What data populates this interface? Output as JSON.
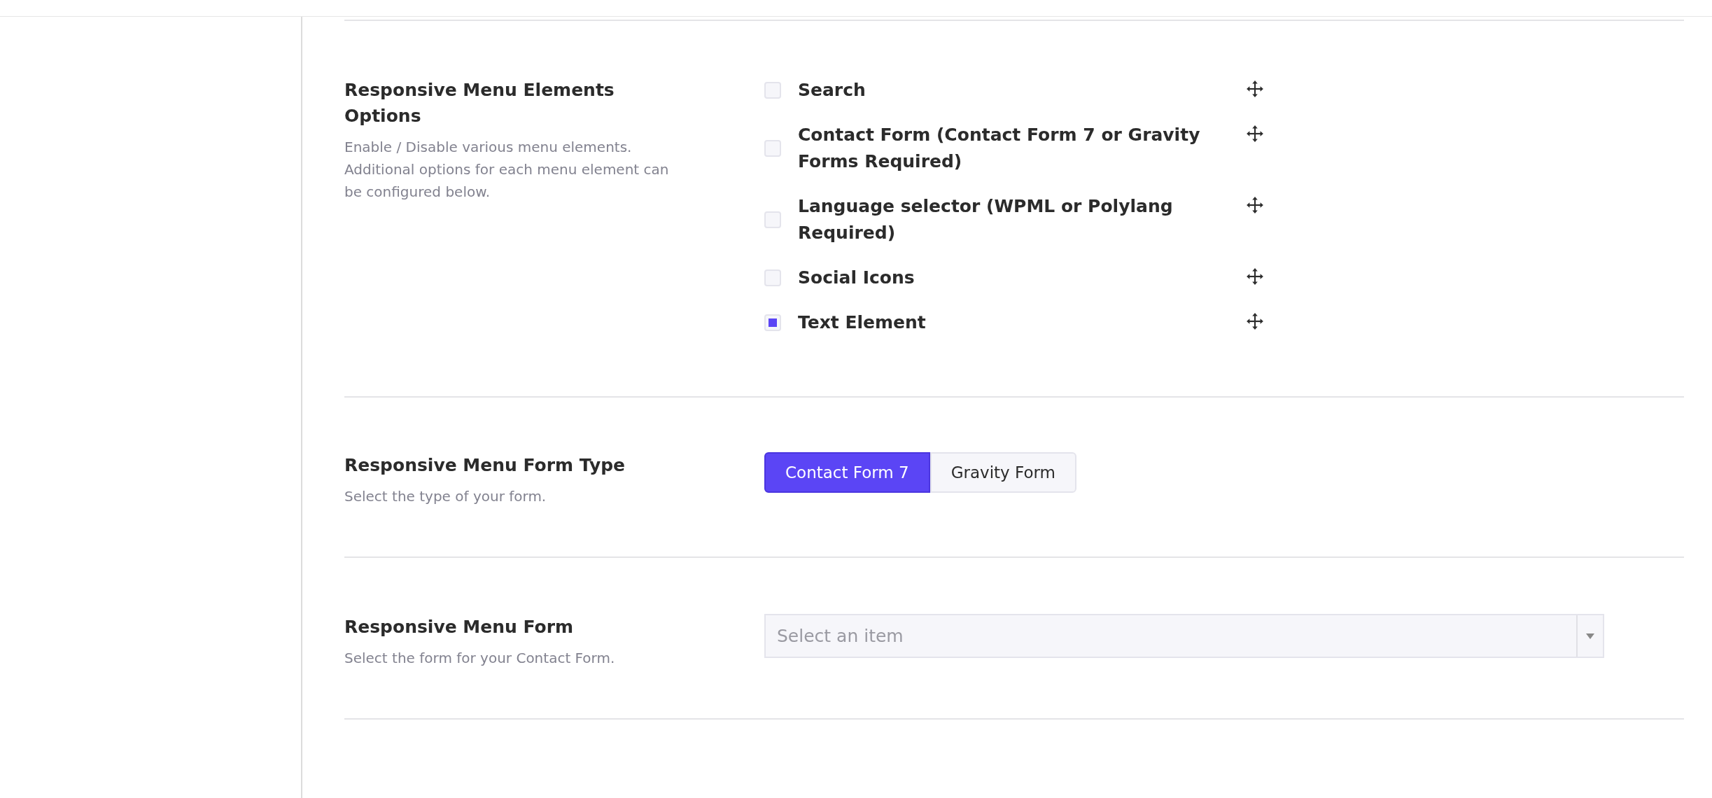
{
  "sections": [
    {
      "kind": "checklist",
      "title": "Responsive Menu Elements Options",
      "description": "Enable / Disable various menu elements. Additional options for each menu element can be configured below.",
      "items": [
        {
          "label": "Search",
          "checked": false
        },
        {
          "label": "Contact Form (Contact Form 7 or Gravity Forms Required)",
          "checked": false
        },
        {
          "label": "Language selector (WPML or Polylang Required)",
          "checked": false
        },
        {
          "label": "Social Icons",
          "checked": false
        },
        {
          "label": "Text Element",
          "checked": true
        }
      ]
    },
    {
      "kind": "toggle",
      "title": "Responsive Menu Form Type",
      "description": "Select the type of your form.",
      "options": [
        {
          "label": "Contact Form 7",
          "selected": true
        },
        {
          "label": "Gravity Form",
          "selected": false
        }
      ]
    },
    {
      "kind": "select",
      "title": "Responsive Menu Form",
      "description": "Select the form for your Contact Form.",
      "placeholder": "Select an item"
    }
  ]
}
